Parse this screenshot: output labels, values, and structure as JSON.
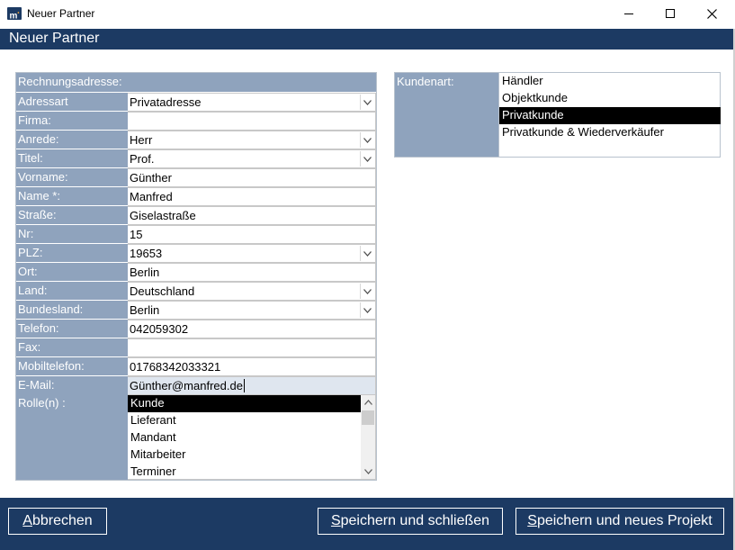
{
  "window": {
    "title": "Neuer Partner",
    "icon": "m-app-icon"
  },
  "header": {
    "title": "Neuer Partner"
  },
  "form": {
    "section_title": "Rechnungsadresse:",
    "fields": [
      {
        "label": "Adressart",
        "value": "Privatadresse",
        "type": "dropdown"
      },
      {
        "label": "Firma:",
        "value": "",
        "type": "text"
      },
      {
        "label": "Anrede:",
        "value": "Herr",
        "type": "dropdown"
      },
      {
        "label": "Titel:",
        "value": "Prof.",
        "type": "dropdown"
      },
      {
        "label": "Vorname:",
        "value": "Günther",
        "type": "text"
      },
      {
        "label": "Name *:",
        "value": "Manfred",
        "type": "text"
      },
      {
        "label": "Straße:",
        "value": "Giselastraße",
        "type": "text"
      },
      {
        "label": "Nr:",
        "value": "15",
        "type": "text"
      },
      {
        "label": "PLZ:",
        "value": "19653",
        "type": "dropdown"
      },
      {
        "label": "Ort:",
        "value": "Berlin",
        "type": "text"
      },
      {
        "label": "Land:",
        "value": "Deutschland",
        "type": "dropdown"
      },
      {
        "label": "Bundesland:",
        "value": "Berlin",
        "type": "dropdown"
      },
      {
        "label": "Telefon:",
        "value": "042059302",
        "type": "text"
      },
      {
        "label": "Fax:",
        "value": "",
        "type": "text"
      },
      {
        "label": "Mobiltelefon:",
        "value": "01768342033321",
        "type": "text"
      },
      {
        "label": "E-Mail:",
        "value": "Günther@manfred.de",
        "type": "text-active"
      }
    ],
    "roles": {
      "label": "Rolle(n) :",
      "items": [
        "Kunde",
        "Lieferant",
        "Mandant",
        "Mitarbeiter",
        "Terminer"
      ],
      "selected": "Kunde"
    }
  },
  "kundenart": {
    "label": "Kundenart:",
    "items": [
      "Händler",
      "Objektkunde",
      "Privatkunde",
      "Privatkunde & Wiederverkäufer"
    ],
    "selected": "Privatkunde"
  },
  "footer": {
    "cancel": {
      "accel": "A",
      "rest": "bbrechen"
    },
    "save_close": {
      "accel": "S",
      "rest": "peichern und schließen"
    },
    "save_new": {
      "accel": "S",
      "rest": "peichern und neues Projekt"
    }
  },
  "colors": {
    "navy": "#1c3a63",
    "label_bg": "#8fa3bd",
    "selection": "#000000"
  }
}
